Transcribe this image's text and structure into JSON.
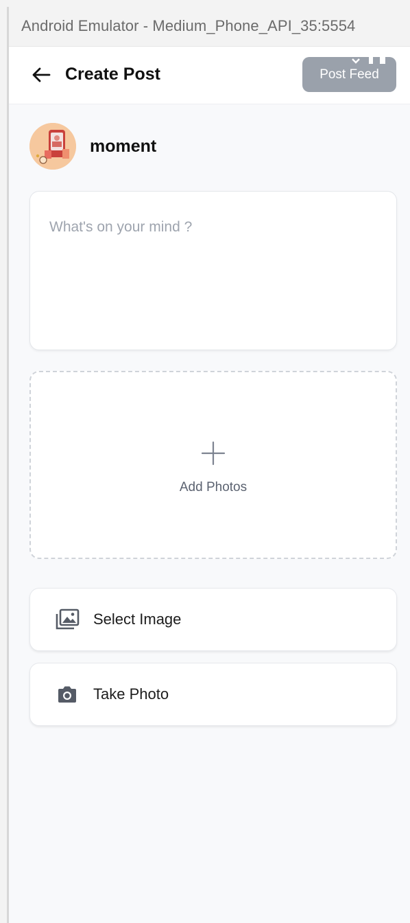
{
  "window": {
    "title": "Android Emulator - Medium_Phone_API_35:5554"
  },
  "appbar": {
    "title": "Create Post",
    "post_button_label": "Post Feed"
  },
  "user": {
    "name": "moment"
  },
  "composer": {
    "placeholder": "What's on your mind ?",
    "value": ""
  },
  "add_photos": {
    "label": "Add Photos"
  },
  "actions": [
    {
      "label": "Select Image",
      "icon": "gallery-icon"
    },
    {
      "label": "Take Photo",
      "icon": "camera-icon"
    }
  ],
  "colors": {
    "accent_disabled": "#9aa1ab",
    "background": "#f8f9fb"
  }
}
